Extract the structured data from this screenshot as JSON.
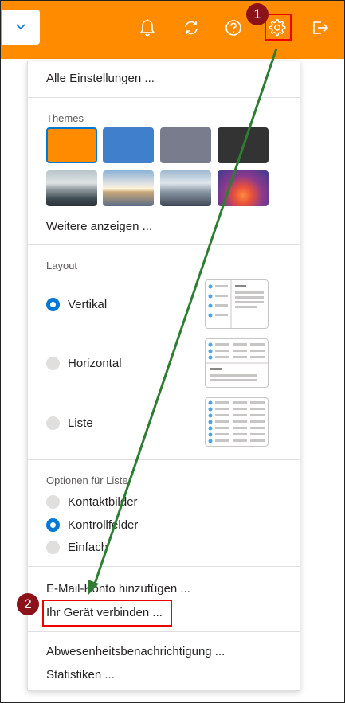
{
  "toolbar": {
    "dropdown_icon": "chevron-down-icon",
    "icons": [
      "bell-icon",
      "sync-icon",
      "help-icon",
      "gear-icon",
      "sign-out-icon"
    ],
    "accent_color": "#ff8c00"
  },
  "annotations": {
    "badge_1": "1",
    "badge_2": "2",
    "highlight_color": "#e00000",
    "badge_color": "#8b1218",
    "arrow_color": "#2e7d32"
  },
  "menu": {
    "all_settings": "Alle Einstellungen ...",
    "themes": {
      "title": "Themes",
      "colors": [
        "#ff8c00",
        "#3f7fcb",
        "#787c8c",
        "#333333"
      ],
      "images": [
        "misty-mountains",
        "beach-sunset",
        "city-skyline",
        "purple-glow"
      ],
      "more": "Weitere anzeigen ..."
    },
    "layout": {
      "title": "Layout",
      "options": [
        {
          "label": "Vertikal",
          "selected": true
        },
        {
          "label": "Horizontal",
          "selected": false
        },
        {
          "label": "Liste",
          "selected": false
        }
      ]
    },
    "list_options": {
      "title": "Optionen für Liste",
      "options": [
        {
          "label": "Kontaktbilder",
          "selected": false
        },
        {
          "label": "Kontrollfelder",
          "selected": true
        },
        {
          "label": "Einfach",
          "selected": false
        }
      ]
    },
    "add_account": "E-Mail-Konto hinzufügen ...",
    "connect_device": "Ihr Gerät verbinden ...",
    "out_of_office": "Abwesenheitsbenachrichtigung ...",
    "statistics": "Statistiken ..."
  }
}
